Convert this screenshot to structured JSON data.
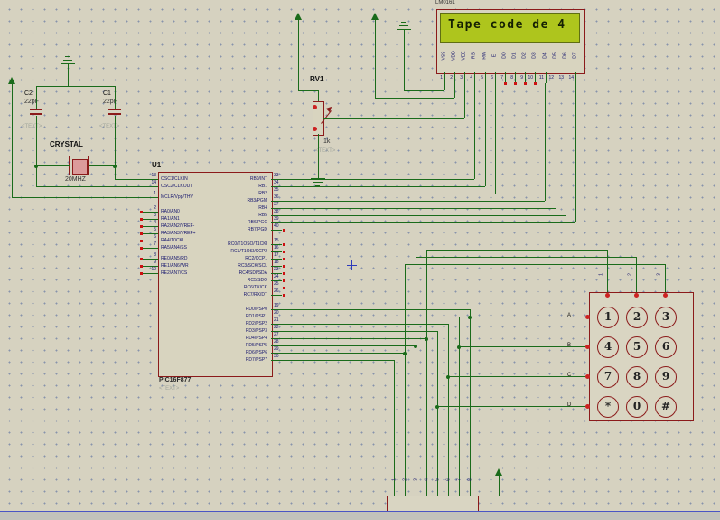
{
  "sheet": {
    "colors": {
      "background": "#d6d2c0",
      "wire": "#1a6b1a",
      "outline": "#8b1a1a",
      "lcd_screen": "#aec51d",
      "marker_red": "#cc1111"
    }
  },
  "lcd": {
    "model": "LM016L",
    "screen_text": "Tape code de 4",
    "pins": [
      {
        "num": "1",
        "name": "VSS"
      },
      {
        "num": "2",
        "name": "VDD"
      },
      {
        "num": "3",
        "name": "VEE"
      },
      {
        "num": "4",
        "name": "RS"
      },
      {
        "num": "5",
        "name": "RW"
      },
      {
        "num": "6",
        "name": "E"
      },
      {
        "num": "7",
        "name": "D0"
      },
      {
        "num": "8",
        "name": "D1"
      },
      {
        "num": "9",
        "name": "D2"
      },
      {
        "num": "10",
        "name": "D3"
      },
      {
        "num": "11",
        "name": "D4"
      },
      {
        "num": "12",
        "name": "D5"
      },
      {
        "num": "13",
        "name": "D6"
      },
      {
        "num": "14",
        "name": "D7"
      }
    ]
  },
  "mcu": {
    "ref": "U1",
    "part": "PIC16F877",
    "placeholder": "<TEXT>",
    "left_pins": [
      {
        "num": "13",
        "name": "OSC1/CLKIN"
      },
      {
        "num": "14",
        "name": "OSC2/CLKOUT"
      },
      {
        "num": "1",
        "name": "MCLR/Vpp/THV"
      },
      {
        "num": "2",
        "name": "RA0/AN0"
      },
      {
        "num": "3",
        "name": "RA1/AN1"
      },
      {
        "num": "4",
        "name": "RA2/AN2/VREF-"
      },
      {
        "num": "5",
        "name": "RA3/AN3/VREF+"
      },
      {
        "num": "6",
        "name": "RA4/T0CKI"
      },
      {
        "num": "7",
        "name": "RA5/AN4/SS"
      },
      {
        "num": "8",
        "name": "RE0/AN5/RD"
      },
      {
        "num": "9",
        "name": "RE1/AN6/WR"
      },
      {
        "num": "10",
        "name": "RE2/AN7/CS"
      }
    ],
    "right_pins": [
      {
        "num": "33",
        "name": "RB0/INT"
      },
      {
        "num": "34",
        "name": "RB1"
      },
      {
        "num": "35",
        "name": "RB2"
      },
      {
        "num": "36",
        "name": "RB3/PGM"
      },
      {
        "num": "37",
        "name": "RB4"
      },
      {
        "num": "38",
        "name": "RB5"
      },
      {
        "num": "39",
        "name": "RB6/PGC"
      },
      {
        "num": "40",
        "name": "RB7/PGD"
      },
      {
        "num": "15",
        "name": "RC0/T1OSO/T1CKI"
      },
      {
        "num": "16",
        "name": "RC1/T1OSI/CCP2"
      },
      {
        "num": "17",
        "name": "RC2/CCP1"
      },
      {
        "num": "18",
        "name": "RC3/SCK/SCL"
      },
      {
        "num": "23",
        "name": "RC4/SDI/SDA"
      },
      {
        "num": "24",
        "name": "RC5/SDO"
      },
      {
        "num": "25",
        "name": "RC6/TX/CK"
      },
      {
        "num": "26",
        "name": "RC7/RX/DT"
      },
      {
        "num": "19",
        "name": "RD0/PSP0"
      },
      {
        "num": "20",
        "name": "RD1/PSP1"
      },
      {
        "num": "21",
        "name": "RD2/PSP2"
      },
      {
        "num": "22",
        "name": "RD3/PSP3"
      },
      {
        "num": "27",
        "name": "RD4/PSP4"
      },
      {
        "num": "28",
        "name": "RD5/PSP5"
      },
      {
        "num": "29",
        "name": "RD6/PSP6"
      },
      {
        "num": "30",
        "name": "RD7/PSP7"
      }
    ]
  },
  "crystal": {
    "label": "CRYSTAL",
    "value": "20MHZ"
  },
  "capacitors": [
    {
      "ref": "C2",
      "value": "22pF",
      "placeholder": "<TEXT>"
    },
    {
      "ref": "C1",
      "value": "22pF",
      "placeholder": "<TEXT>"
    }
  ],
  "pot": {
    "ref": "RV1",
    "value": "1k",
    "placeholder": "<TEXT>"
  },
  "keypad": {
    "row_labels": [
      "A",
      "B",
      "C",
      "D"
    ],
    "col_labels": [
      "1",
      "2",
      "3"
    ],
    "keys": [
      [
        "1",
        "2",
        "3"
      ],
      [
        "4",
        "5",
        "6"
      ],
      [
        "7",
        "8",
        "9"
      ],
      [
        "*",
        "0",
        "#"
      ]
    ]
  },
  "connector": {
    "pin_labels": [
      "1",
      "2",
      "3",
      "4",
      "5",
      "6",
      "7",
      "8"
    ]
  }
}
